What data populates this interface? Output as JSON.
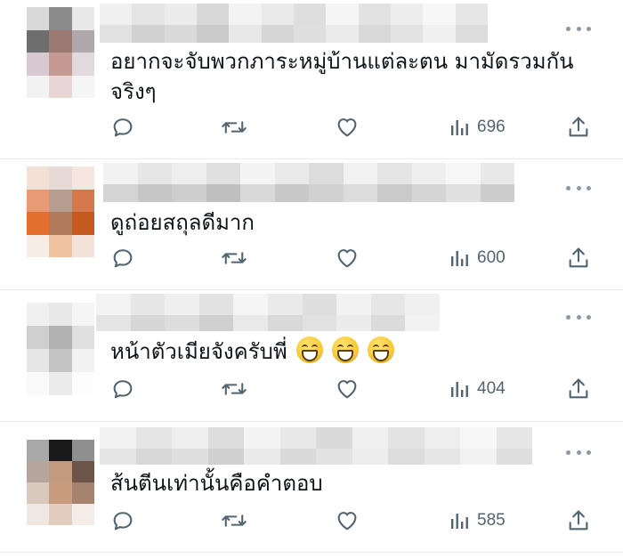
{
  "replies": [
    {
      "text": "อยากจะจับพวกภาระหมู่บ้านแต่ละตน มามัดรวมกันจริงๆ",
      "views": "696",
      "emoji_count": 0,
      "avatar_colors": [
        "#d9d9d9",
        "#8c8c8c",
        "#e8e8e8",
        "#6e6e6e",
        "#9a7a72",
        "#b0a8aa",
        "#d7c9cf",
        "#c49a92",
        "#e2d9de",
        "#f2f2f2",
        "#e8d6d6",
        "#f5f5f5"
      ]
    },
    {
      "text": "ดูถ่อยสถุลดีมาก",
      "views": "600",
      "emoji_count": 0,
      "avatar_colors": [
        "#f3e1d7",
        "#e6dad6",
        "#f5e6df",
        "#e89a74",
        "#b79c90",
        "#d6784d",
        "#e36f2f",
        "#b07a5a",
        "#c45a1f",
        "#f7ece6",
        "#f0c3a1",
        "#f3e3da"
      ]
    },
    {
      "text": "หน้าตัวเมียจังครับพี่",
      "views": "404",
      "emoji_count": 3,
      "avatar_colors": [
        "#f0f0f0",
        "#e8e8e8",
        "#f5f5f5",
        "#cfcfcf",
        "#b3b3b3",
        "#e0e0e0",
        "#e6e6e6",
        "#c4c4c4",
        "#f2f2f2",
        "#fafafa",
        "#ebebeb",
        "#fdfdfd"
      ]
    },
    {
      "text": "ส้นตีนเท่านั้นคือคำตอบ",
      "views": "585",
      "emoji_count": 0,
      "avatar_colors": [
        "#a8a8a8",
        "#1a1a1a",
        "#8f8f8f",
        "#b5a59c",
        "#c29a7e",
        "#6b5448",
        "#d8c8bd",
        "#c79c7f",
        "#a4836f",
        "#efe7e2",
        "#e2cdbf",
        "#f3ece7"
      ]
    }
  ]
}
